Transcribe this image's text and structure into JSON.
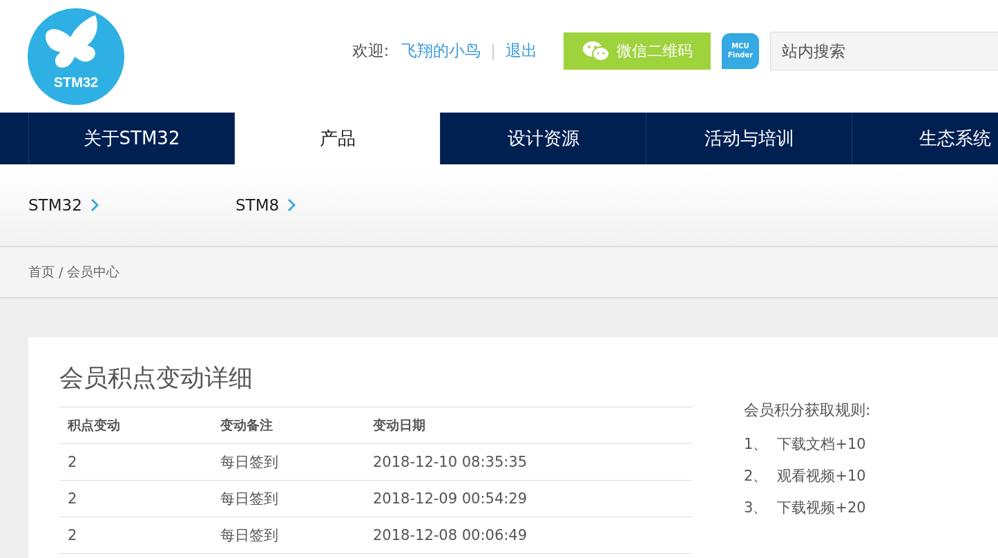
{
  "header": {
    "logo_text": "STM32",
    "welcome_label": "欢迎:",
    "username": "飞翔的小鸟",
    "separator": "|",
    "logout": "退出",
    "wechat_button": "微信二维码",
    "mcu_finder": {
      "line1": "MCU",
      "line2": "Finder"
    },
    "search": {
      "placeholder": "站内搜索"
    }
  },
  "nav": [
    {
      "label": "关于STM32",
      "selected": false
    },
    {
      "label": "产品",
      "selected": true
    },
    {
      "label": "设计资源",
      "selected": false
    },
    {
      "label": "活动与培训",
      "selected": false
    },
    {
      "label": "生态系统",
      "selected": false
    }
  ],
  "subnav": [
    "STM32",
    "STM8"
  ],
  "breadcrumb": {
    "home": "首页",
    "separator": "/",
    "current": "会员中心"
  },
  "content": {
    "title": "会员积点变动详细",
    "table": {
      "columns": [
        "积点变动",
        "变动备注",
        "变动日期"
      ],
      "rows": [
        [
          "2",
          "每日签到",
          "2018-12-10 08:35:35"
        ],
        [
          "2",
          "每日签到",
          "2018-12-09 00:54:29"
        ],
        [
          "2",
          "每日签到",
          "2018-12-08 00:06:49"
        ]
      ]
    },
    "rules": {
      "title": "会员积分获取规则:",
      "items": [
        {
          "num": "1、",
          "text": "下载文档+10"
        },
        {
          "num": "2、",
          "text": "观看视频+10"
        },
        {
          "num": "3、",
          "text": "下载视频+20"
        }
      ]
    }
  }
}
